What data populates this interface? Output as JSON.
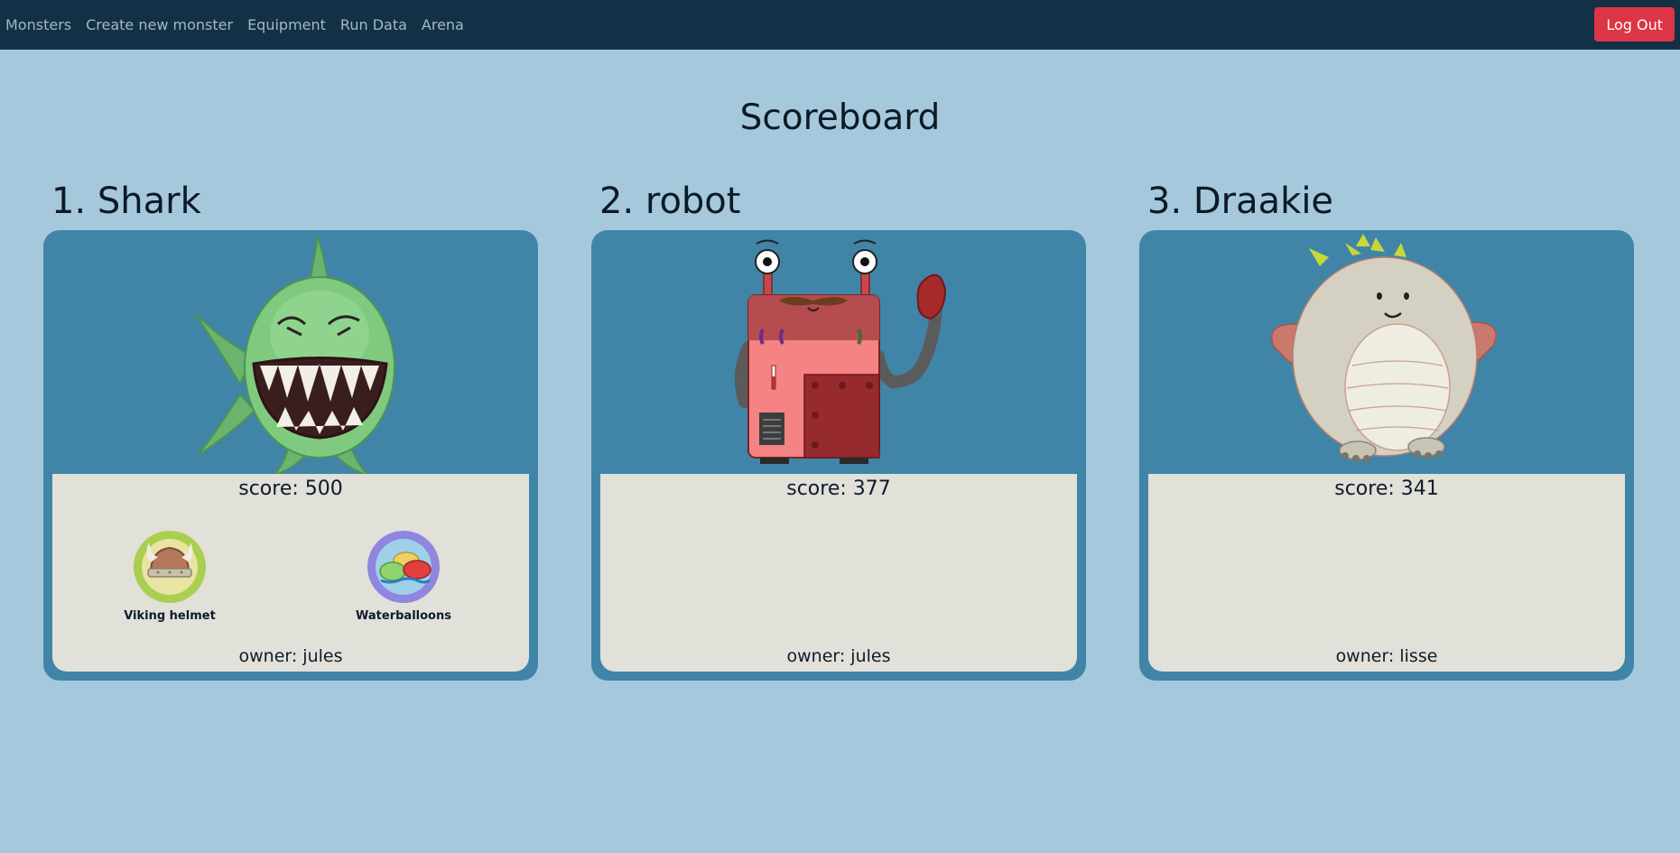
{
  "nav": {
    "links": [
      "Monsters",
      "Create new monster",
      "Equipment",
      "Run Data",
      "Arena"
    ],
    "logout_label": "Log Out"
  },
  "page": {
    "title": "Scoreboard"
  },
  "colors": {
    "navbar": "#123147",
    "background": "#a6c8dc",
    "card": "#4085a8",
    "info_panel": "#e1e0d9",
    "logout": "#dc3545"
  },
  "monsters": [
    {
      "rank_title": "1. Shark",
      "image": "shark-monster",
      "score": "score: 500",
      "owner": "owner: jules",
      "equipment": [
        {
          "name": "Viking helmet",
          "icon": "viking-helmet-icon"
        },
        {
          "name": "Waterballoons",
          "icon": "waterballoons-icon"
        }
      ]
    },
    {
      "rank_title": "2. robot",
      "image": "robot-monster",
      "score": "score: 377",
      "owner": "owner: jules",
      "equipment": []
    },
    {
      "rank_title": "3. Draakie",
      "image": "dragon-monster",
      "score": "score: 341",
      "owner": "owner: lisse",
      "equipment": []
    }
  ]
}
